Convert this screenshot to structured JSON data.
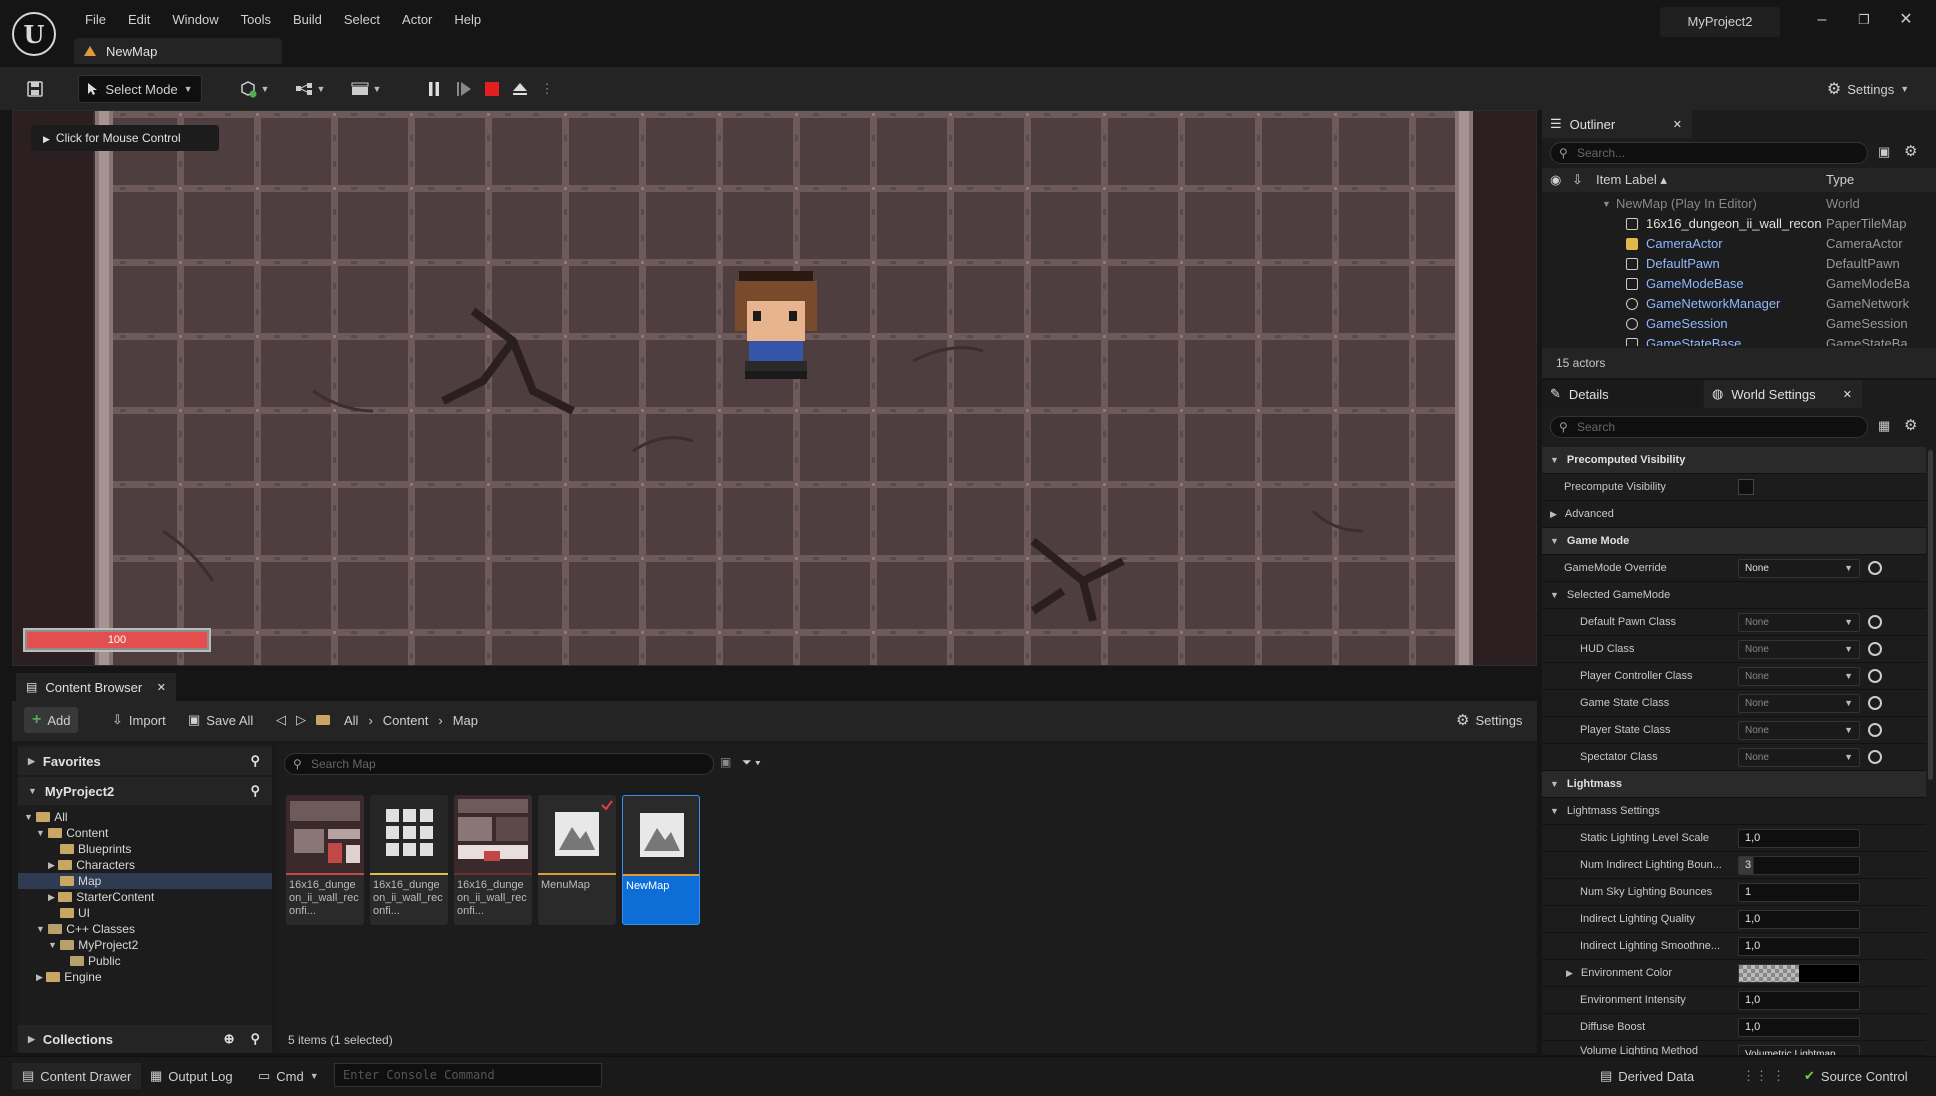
{
  "menu": [
    "File",
    "Edit",
    "Window",
    "Tools",
    "Build",
    "Select",
    "Actor",
    "Help"
  ],
  "tab_title": "NewMap",
  "project_name": "MyProject2",
  "toolbar": {
    "select_mode": "Select Mode",
    "settings": "Settings"
  },
  "viewport": {
    "mouse_control": "Click for Mouse Control",
    "health": "100",
    "health_fraction": 1.0
  },
  "content_browser": {
    "tab": "Content Browser",
    "add": "Add",
    "import": "Import",
    "save_all": "Save All",
    "breadcrumb": [
      "All",
      "Content",
      "Map"
    ],
    "settings": "Settings",
    "search_placeholder": "Search Map",
    "favorites": "Favorites",
    "project": "MyProject2",
    "collections": "Collections",
    "tree": [
      "All",
      "Content",
      "Blueprints",
      "Characters",
      "Map",
      "StarterContent",
      "UI",
      "C++ Classes",
      "MyProject2",
      "Public",
      "Engine"
    ],
    "assets": [
      {
        "label": "16x16_dungeon_ii_wall_reconfi..."
      },
      {
        "label": "16x16_dungeon_ii_wall_reconfi..."
      },
      {
        "label": "16x16_dungeon_ii_wall_reconfi..."
      },
      {
        "label": "MenuMap"
      },
      {
        "label": "NewMap"
      }
    ],
    "items_count": "5 items (1 selected)"
  },
  "status": {
    "content_drawer": "Content Drawer",
    "output_log": "Output Log",
    "cmd": "Cmd",
    "console_placeholder": "Enter Console Command",
    "derived_data": "Derived Data",
    "source_control": "Source Control"
  },
  "outliner": {
    "tab": "Outliner",
    "search_placeholder": "Search...",
    "col_label": "Item Label",
    "col_type": "Type",
    "rows": [
      {
        "name": "NewMap (Play In Editor)",
        "type": "World"
      },
      {
        "name": "16x16_dungeon_ii_wall_recon",
        "type": "PaperTileMap"
      },
      {
        "name": "CameraActor",
        "type": "CameraActor"
      },
      {
        "name": "DefaultPawn",
        "type": "DefaultPawn"
      },
      {
        "name": "GameModeBase",
        "type": "GameModeBa"
      },
      {
        "name": "GameNetworkManager",
        "type": "GameNetwork"
      },
      {
        "name": "GameSession",
        "type": "GameSession"
      },
      {
        "name": "GameStateBase",
        "type": "GameStateBa"
      }
    ],
    "count": "15 actors"
  },
  "details": {
    "tab": "Details",
    "tab2": "World Settings",
    "search_placeholder": "Search",
    "precomputed_visibility": "Precomputed Visibility",
    "precompute_visibility": "Precompute Visibility",
    "advanced": "Advanced",
    "game_mode": "Game Mode",
    "gamemode_override": "GameMode Override",
    "gamemode_override_value": "None",
    "selected_gamemode": "Selected GameMode",
    "selected_rows": [
      {
        "label": "Default Pawn Class",
        "value": "None"
      },
      {
        "label": "HUD Class",
        "value": "None"
      },
      {
        "label": "Player Controller Class",
        "value": "None"
      },
      {
        "label": "Game State Class",
        "value": "None"
      },
      {
        "label": "Player State Class",
        "value": "None"
      },
      {
        "label": "Spectator Class",
        "value": "None"
      }
    ],
    "lightmass": "Lightmass",
    "lightmass_settings": "Lightmass Settings",
    "lightmass_rows": [
      {
        "label": "Static Lighting Level Scale",
        "value": "1,0"
      },
      {
        "label": "Num Indirect Lighting Boun...",
        "value": "3"
      },
      {
        "label": "Num Sky Lighting Bounces",
        "value": "1"
      },
      {
        "label": "Indirect Lighting Quality",
        "value": "1,0"
      },
      {
        "label": "Indirect Lighting Smoothne...",
        "value": "1,0"
      }
    ],
    "environment_color": "Environment Color",
    "lightmass_rows2": [
      {
        "label": "Environment Intensity",
        "value": "1,0"
      },
      {
        "label": "Diffuse Boost",
        "value": "1,0"
      }
    ],
    "volume_lighting_method": "Volume Lighting Method",
    "volume_lighting_value": "Volumetric Lightmap"
  }
}
